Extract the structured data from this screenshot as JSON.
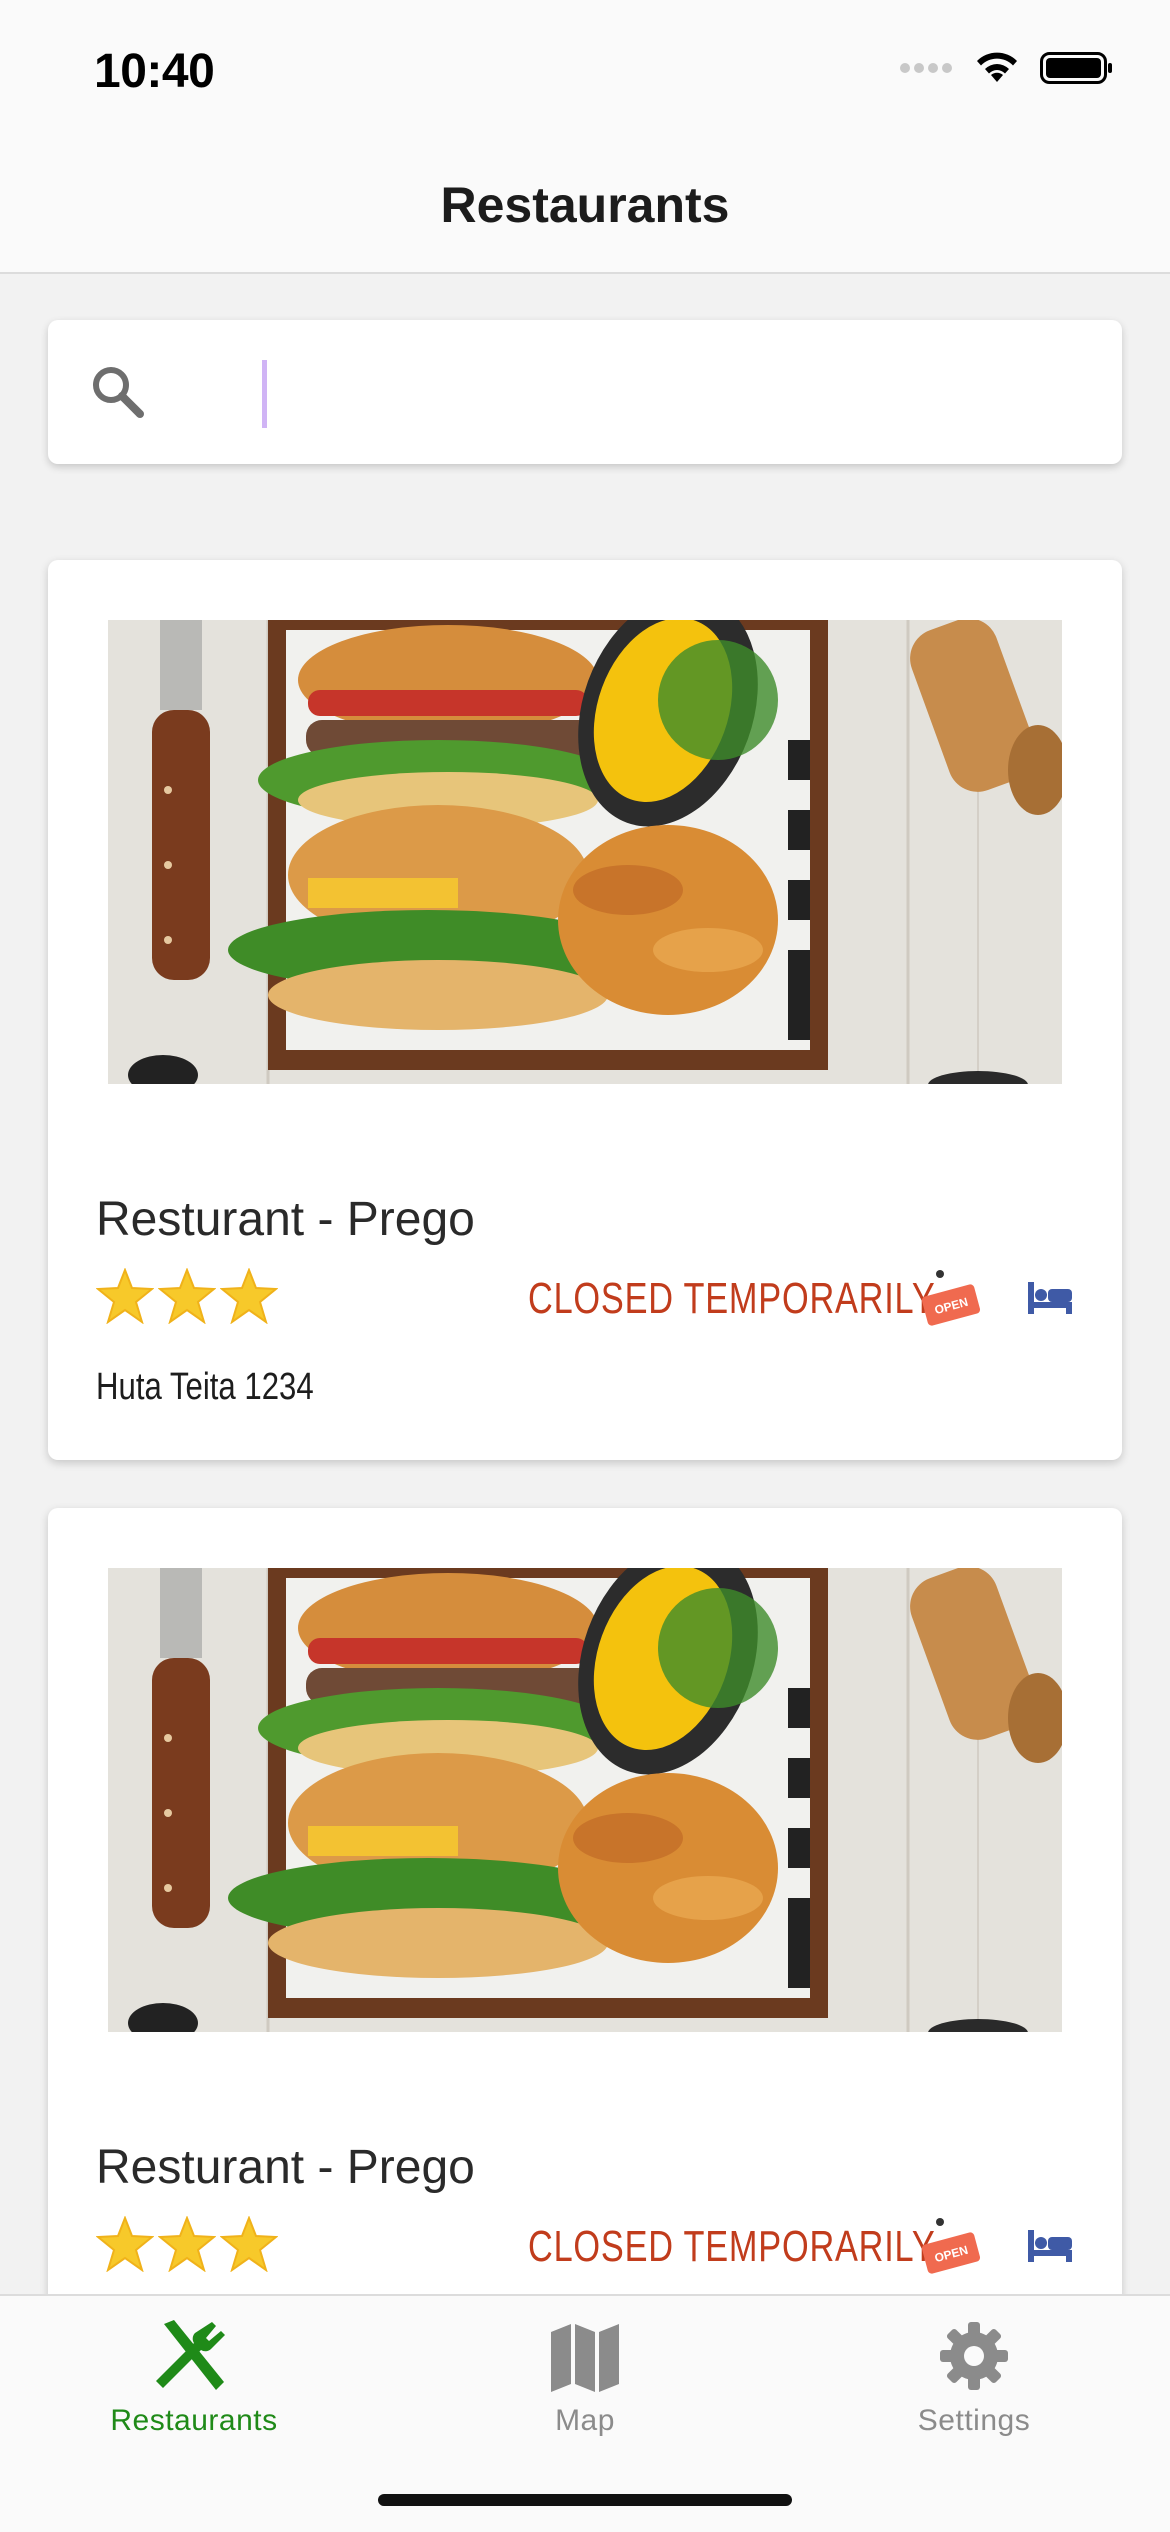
{
  "status_bar": {
    "time": "10:40",
    "icons": [
      "signal-dots-icon",
      "wifi-icon",
      "battery-icon"
    ]
  },
  "nav": {
    "title": "Restaurants"
  },
  "search": {
    "value": "",
    "placeholder": "",
    "icon": "search-icon"
  },
  "restaurants": [
    {
      "name": "Resturant - Prego",
      "rating": 3,
      "status": "CLOSED TEMPORARILY",
      "address": "Huta Teita 1234",
      "icons": [
        "open-sign-icon",
        "bed-icon"
      ]
    },
    {
      "name": "Resturant - Prego",
      "rating": 3,
      "status": "CLOSED TEMPORARILY",
      "icons": [
        "open-sign-icon",
        "bed-icon"
      ]
    }
  ],
  "open_sign_text": "OPEN",
  "tabs": [
    {
      "label": "Restaurants",
      "icon": "fork-knife-icon",
      "active": true
    },
    {
      "label": "Map",
      "icon": "map-icon",
      "active": false
    },
    {
      "label": "Settings",
      "icon": "gear-icon",
      "active": false
    }
  ],
  "colors": {
    "accent_active": "#1f8a18",
    "tab_inactive": "#8b8b8b",
    "status_closed": "#c13c1c",
    "bed_icon": "#3f5aa6",
    "open_sign": "#f06a4f",
    "caret": "#d0b4f5"
  }
}
